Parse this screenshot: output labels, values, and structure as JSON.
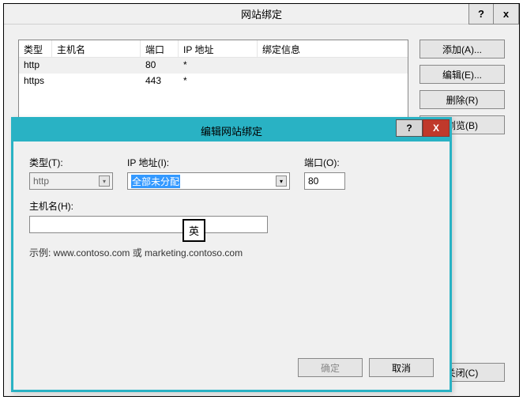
{
  "parent": {
    "title": "网站绑定",
    "help_label": "?",
    "close_label": "x",
    "columns": {
      "type": "类型",
      "host": "主机名",
      "port": "端口",
      "ip": "IP 地址",
      "info": "绑定信息"
    },
    "rows": [
      {
        "type": "http",
        "host": "",
        "port": "80",
        "ip": "*",
        "info": ""
      },
      {
        "type": "https",
        "host": "",
        "port": "443",
        "ip": "*",
        "info": ""
      }
    ],
    "buttons": {
      "add": "添加(A)...",
      "edit": "编辑(E)...",
      "remove": "删除(R)",
      "browse": "浏览(B)",
      "close": "关闭(C)"
    }
  },
  "modal": {
    "title": "编辑网站绑定",
    "help_label": "?",
    "close_label": "X",
    "labels": {
      "type": "类型(T):",
      "ip": "IP 地址(I):",
      "port": "端口(O):",
      "host": "主机名(H):"
    },
    "values": {
      "type": "http",
      "ip": "全部未分配",
      "port": "80",
      "host": ""
    },
    "example": "示例: www.contoso.com 或 marketing.contoso.com",
    "ime": "英",
    "buttons": {
      "ok": "确定",
      "cancel": "取消"
    }
  }
}
